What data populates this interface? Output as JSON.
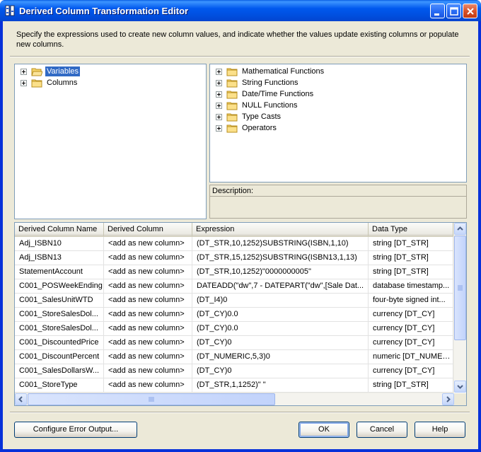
{
  "window": {
    "title": "Derived Column Transformation Editor"
  },
  "description": "Specify the expressions used to create new column values, and indicate whether the values update existing columns or populate new columns.",
  "left_tree": {
    "items": [
      {
        "label": "Variables",
        "selected": true
      },
      {
        "label": "Columns",
        "selected": false
      }
    ]
  },
  "right_tree": {
    "items": [
      {
        "label": "Mathematical Functions"
      },
      {
        "label": "String Functions"
      },
      {
        "label": "Date/Time Functions"
      },
      {
        "label": "NULL Functions"
      },
      {
        "label": "Type Casts"
      },
      {
        "label": "Operators"
      }
    ]
  },
  "description_pane": {
    "label": "Description:"
  },
  "grid": {
    "columns": [
      "Derived Column Name",
      "Derived Column",
      "Expression",
      "Data Type"
    ],
    "rows": [
      [
        "Adj_ISBN10",
        "<add as new column>",
        "(DT_STR,10,1252)SUBSTRING(ISBN,1,10)",
        "string [DT_STR]"
      ],
      [
        "Adj_ISBN13",
        "<add as new column>",
        "(DT_STR,15,1252)SUBSTRING(ISBN13,1,13)",
        "string [DT_STR]"
      ],
      [
        "StatementAccount",
        "<add as new column>",
        "(DT_STR,10,1252)\"0000000005\"",
        "string [DT_STR]"
      ],
      [
        "C001_POSWeekEnding",
        "<add as new column>",
        "DATEADD(\"dw\",7 - DATEPART(\"dw\",[Sale Dat...",
        "database timestamp..."
      ],
      [
        "C001_SalesUnitWTD",
        "<add as new column>",
        "(DT_I4)0",
        "four-byte signed int..."
      ],
      [
        "C001_StoreSalesDol...",
        "<add as new column>",
        "(DT_CY)0.0",
        "currency [DT_CY]"
      ],
      [
        "C001_StoreSalesDol...",
        "<add as new column>",
        "(DT_CY)0.0",
        "currency [DT_CY]"
      ],
      [
        "C001_DiscountedPrice",
        "<add as new column>",
        "(DT_CY)0",
        "currency [DT_CY]"
      ],
      [
        "C001_DiscountPercent",
        "<add as new column>",
        "(DT_NUMERIC,5,3)0",
        "numeric [DT_NUMER..."
      ],
      [
        "C001_SalesDollarsW...",
        "<add as new column>",
        "(DT_CY)0",
        "currency [DT_CY]"
      ],
      [
        "C001_StoreType",
        "<add as new column>",
        "(DT_STR,1,1252)\" \"",
        "string [DT_STR]"
      ]
    ]
  },
  "buttons": {
    "configure": "Configure Error Output...",
    "ok": "OK",
    "cancel": "Cancel",
    "help": "Help"
  },
  "icons": {
    "title": "ssis-component-icon",
    "tree_node": "folder-icon"
  },
  "colors": {
    "selection": "#316ac5",
    "dialog_bg": "#ece9d8",
    "titlebar": "#0058ee"
  }
}
